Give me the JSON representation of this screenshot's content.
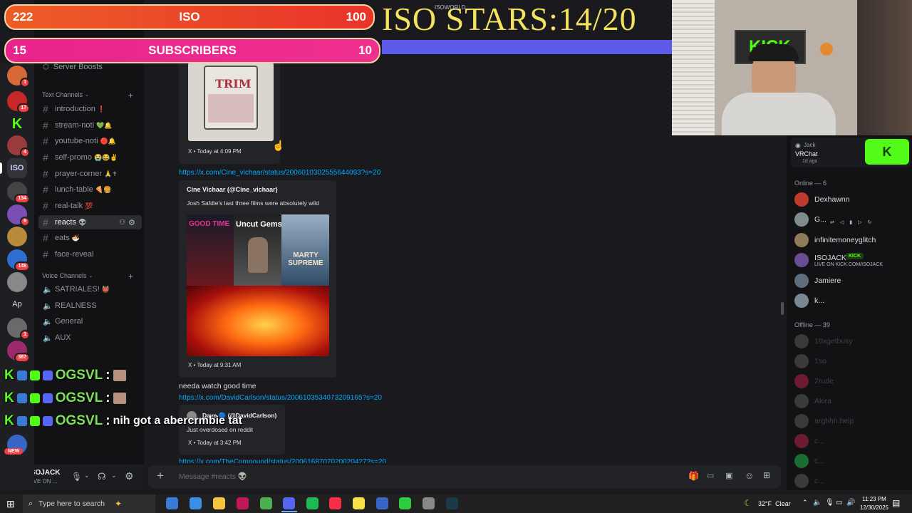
{
  "window": {
    "title": "ISOWORLD"
  },
  "overlay": {
    "iso_bar": {
      "left": "222",
      "label": "ISO",
      "right": "100"
    },
    "sub_bar": {
      "left": "15",
      "label": "SUBSCRIBERS",
      "right": "10"
    },
    "stars_text": "ISO STARS:14/20",
    "chat": [
      {
        "user": "OGSVL",
        "message": ""
      },
      {
        "user": "OGSVL",
        "message": ""
      },
      {
        "user": "OGSVL",
        "message": "nih got a abercrmbie tat"
      }
    ]
  },
  "server_rail": {
    "badges": [
      "1",
      "17",
      "4",
      "134",
      "6",
      "148",
      "1",
      "367"
    ],
    "iso_label": "ISO",
    "ap_label": "Ap",
    "new_label": "NEW"
  },
  "sidebar": {
    "server_boosts": "Server Boosts",
    "text_category": "Text Channels",
    "text_channels": [
      {
        "name": "introduction",
        "emoji": "❗"
      },
      {
        "name": "stream-noti",
        "emoji": "💚🔔"
      },
      {
        "name": "youtube-noti",
        "emoji": "🔴🔔"
      },
      {
        "name": "self-promo",
        "emoji": "😭😂✌"
      },
      {
        "name": "prayer-corner",
        "emoji": "🙏✝"
      },
      {
        "name": "lunch-table",
        "emoji": "🍕🍔"
      },
      {
        "name": "real-talk",
        "emoji": "💯"
      },
      {
        "name": "reacts",
        "emoji": "👽"
      },
      {
        "name": "eats",
        "emoji": "🍜"
      },
      {
        "name": "face-reveal",
        "emoji": ""
      }
    ],
    "voice_category": "Voice Channels",
    "voice_channels": [
      {
        "name": "SATRIALES!",
        "emoji": "👹"
      },
      {
        "name": "REALNESS",
        "emoji": ""
      },
      {
        "name": "General",
        "emoji": ""
      },
      {
        "name": "AUX",
        "emoji": ""
      }
    ],
    "user": {
      "name": "ISOJACK",
      "status": "LIVE ON ..."
    }
  },
  "chat": {
    "embed1_footer": "X • Today at 4:09 PM",
    "link1": "https://x.com/Cine_vichaar/status/2006010302555644093?s=20",
    "embed2": {
      "author": "Cine Vichaar (@Cine_vichaar)",
      "text": "Josh Safdie's last three films were absolutely wild",
      "poster1": "GOOD TIME",
      "poster2": "Uncut Gems",
      "poster3": "MARTY SUPREME",
      "footer": "X • Today at 9:31 AM"
    },
    "message2": "needa watch good time",
    "link2": "https://x.com/DavidCarlson/status/2006103534073209165?s=20",
    "embed3": {
      "author": "Dave 🔵 (@DavidCarlson)",
      "text": "Just overdosed on reddit",
      "footer": "X • Today at 3:42 PM"
    },
    "link3": "https://x.com/TheCompound/status/2006168707020020427?s=20",
    "input_placeholder": "Message #reacts 👽"
  },
  "members": {
    "activity": {
      "name": "Jack",
      "app": "VRChat",
      "time": "1d ago"
    },
    "online_header": "Online — 6",
    "online": [
      {
        "name": "Dexhawnn",
        "sub": "",
        "color": "#c0392b"
      },
      {
        "name": "G...",
        "sub": "",
        "color": "#7f8c8d"
      },
      {
        "name": "infinitemoneyglitch",
        "sub": "",
        "color": "#8e7b5a"
      },
      {
        "name": "ISOJACK",
        "sub": "LIVE ON KICK.COM/ISOJACK",
        "color": "#6a4c93"
      },
      {
        "name": "Jamiere",
        "sub": "",
        "color": "#5d6d7e"
      },
      {
        "name": "k...",
        "sub": "",
        "color": "#7b8794"
      }
    ],
    "offline_header": "Offline — 39",
    "offline": [
      {
        "name": "10xgetbusy",
        "color": "#555"
      },
      {
        "name": "1so",
        "color": "#555"
      },
      {
        "name": "2rude",
        "color": "#a24"
      },
      {
        "name": "Akira",
        "color": "#555"
      },
      {
        "name": "arghhh.help",
        "color": "#555"
      },
      {
        "name": "c...",
        "color": "#a24"
      },
      {
        "name": "c...",
        "color": "#2a4"
      },
      {
        "name": "c...",
        "color": "#555"
      }
    ]
  },
  "taskbar": {
    "search_placeholder": "Type here to search",
    "weather": "32°F  Clear",
    "time": "11:23 PM",
    "date": "12/30/2025"
  }
}
